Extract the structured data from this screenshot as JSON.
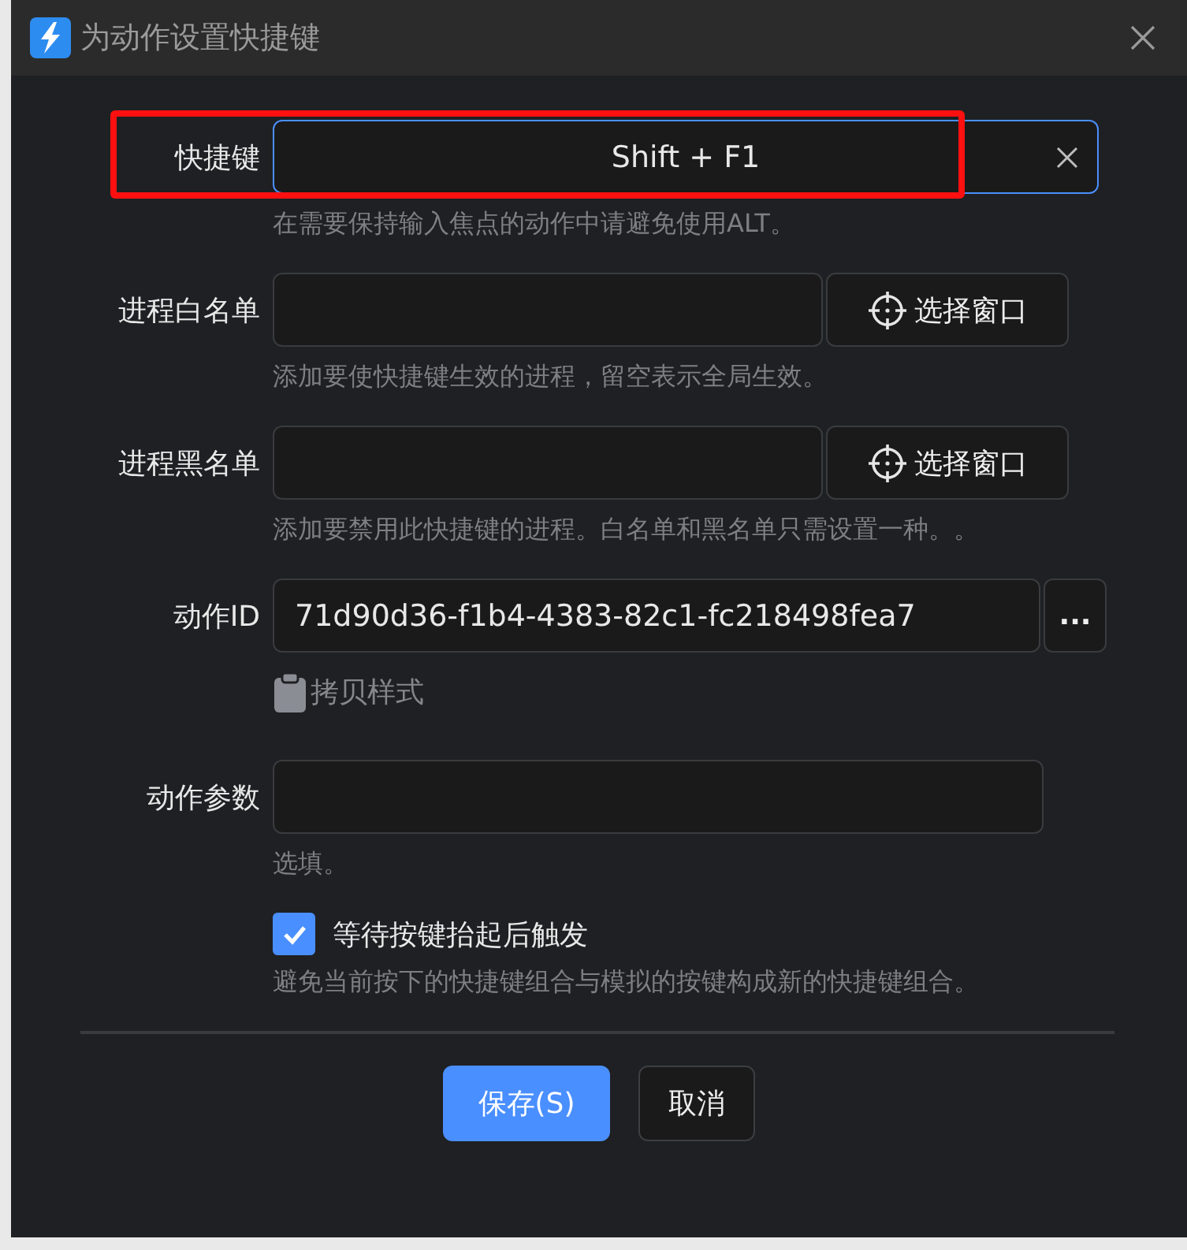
{
  "window": {
    "title": "为动作设置快捷键"
  },
  "fields": [
    {
      "kind": "shortcut",
      "label": "快捷键",
      "value": "Shift + F1",
      "focused": true,
      "highlighted": true,
      "hint": "在需要保持输入焦点的动作中请避免使用ALT。"
    },
    {
      "kind": "picker",
      "label": "进程白名单",
      "button": "选择窗口",
      "hint": "添加要使快捷键生效的进程，留空表示全局生效。"
    },
    {
      "kind": "picker",
      "label": "进程黑名单",
      "button": "选择窗口",
      "hint": "添加要禁用此快捷键的进程。白名单和黑名单只需设置一种。。"
    },
    {
      "kind": "id",
      "label": "动作ID",
      "value": "71d90d36-f1b4-4383-82c1-fc218498fea7",
      "button": "...",
      "link": "拷贝样式"
    },
    {
      "kind": "text",
      "label": "动作参数",
      "hint": "选填。"
    }
  ],
  "checkbox": {
    "label": "等待按键抬起后触发",
    "checked": true,
    "hint": "避免当前按下的快捷键组合与模拟的按键构成新的快捷键组合。"
  },
  "buttons": [
    {
      "label": "保存(S)",
      "primary": true
    },
    {
      "label": "取消",
      "primary": false
    }
  ]
}
